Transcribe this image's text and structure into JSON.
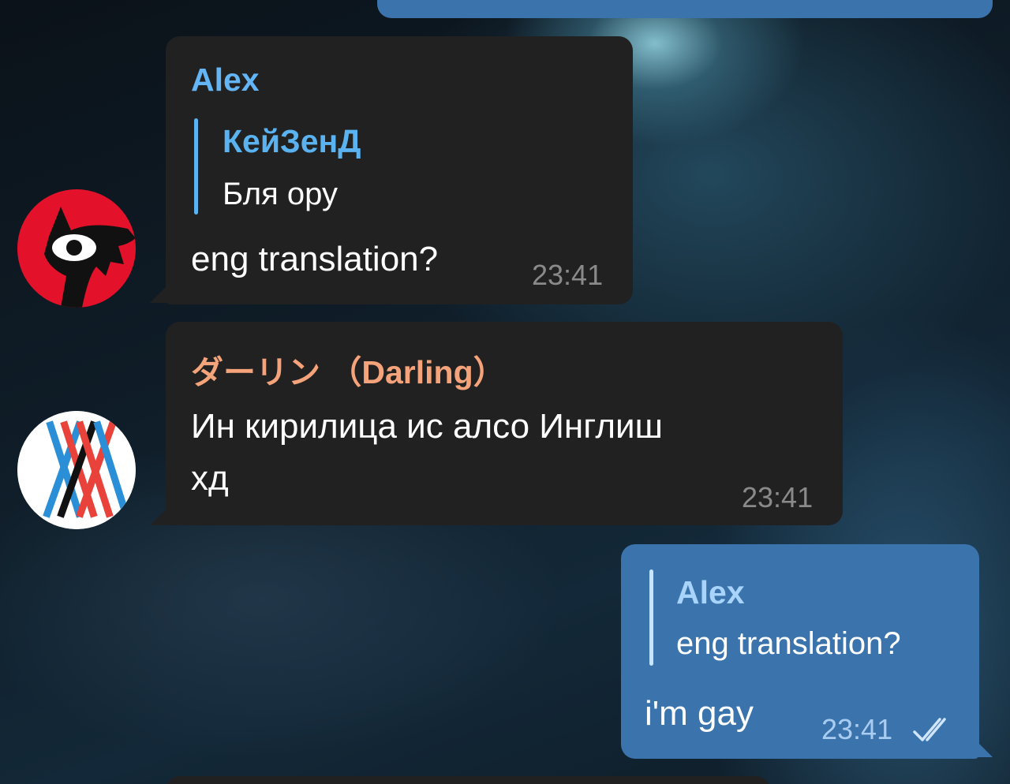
{
  "colors": {
    "incoming_bubble": "#212121",
    "outgoing_bubble": "#3b73ad",
    "alex_name": "#64b5f6",
    "darling_name": "#f5a37a",
    "reply_accent": "#5ab3f0",
    "time_incoming": "#8a8a8a",
    "time_outgoing": "#a9cdf0"
  },
  "messages": [
    {
      "sender": "Alex",
      "avatar": "red-creature-avatar",
      "reply": {
        "name": "КейЗенД",
        "text": "Бля ору"
      },
      "text": "eng translation?",
      "time": "23:41"
    },
    {
      "sender": "ダーリン （Darling）",
      "avatar": "darling-xx-avatar",
      "lines": [
        "Ин кирилица ис алсо Инглиш",
        "хд"
      ],
      "time": "23:41"
    },
    {
      "outgoing": true,
      "reply": {
        "name": "Alex",
        "text": "eng translation?"
      },
      "text": "i'm gay",
      "time": "23:41",
      "status_icon": "double-check-icon"
    }
  ]
}
